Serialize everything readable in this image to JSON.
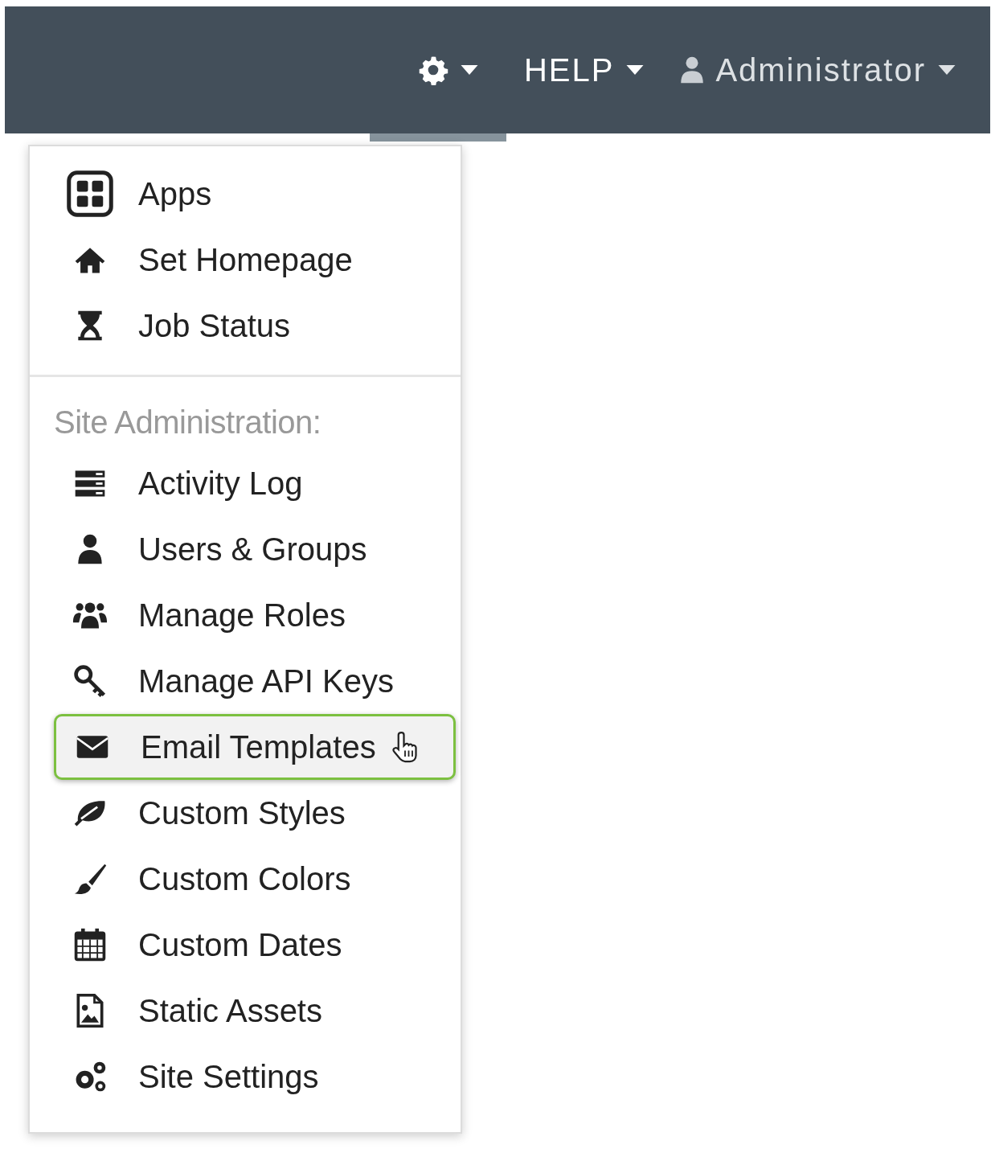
{
  "navbar": {
    "items": [
      {
        "kind": "settings",
        "selected": true
      },
      {
        "kind": "help",
        "label": "HELP",
        "selected": false
      },
      {
        "kind": "user",
        "label": "Administrator",
        "selected": false
      }
    ]
  },
  "menu": {
    "sections": [
      {
        "items": [
          {
            "label": "Apps",
            "selected": false
          },
          {
            "label": "Set Homepage",
            "selected": false
          },
          {
            "label": "Job Status",
            "selected": false
          }
        ]
      },
      {
        "header": "Site Administration:",
        "items": [
          {
            "label": "Activity Log",
            "selected": false
          },
          {
            "label": "Users & Groups",
            "selected": false
          },
          {
            "label": "Manage Roles",
            "selected": false
          },
          {
            "label": "Manage API Keys",
            "selected": false
          },
          {
            "label": "Email Templates",
            "selected": true
          },
          {
            "label": "Custom Styles",
            "selected": false
          },
          {
            "label": "Custom Colors",
            "selected": false
          },
          {
            "label": "Custom Dates",
            "selected": false
          },
          {
            "label": "Static Assets",
            "selected": false
          },
          {
            "label": "Site Settings",
            "selected": false
          }
        ]
      }
    ]
  }
}
